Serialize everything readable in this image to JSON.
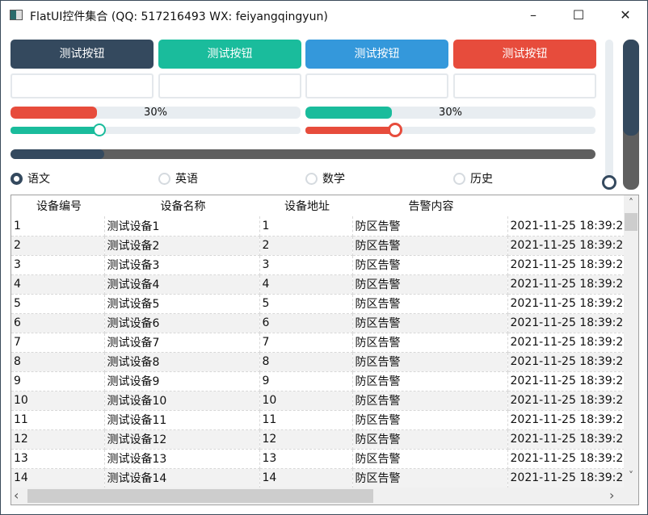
{
  "window": {
    "title": "FlatUI控件集合 (QQ: 517216493 WX: feiyangqingyun)",
    "minimize": "–",
    "maximize": "☐",
    "close": "✕"
  },
  "buttons": [
    {
      "label": "测试按钮",
      "color": "#34495e"
    },
    {
      "label": "测试按钮",
      "color": "#1abc9c"
    },
    {
      "label": "测试按钮",
      "color": "#3498db"
    },
    {
      "label": "测试按钮",
      "color": "#e74c3c"
    }
  ],
  "inputs": [
    {
      "value": ""
    },
    {
      "value": ""
    },
    {
      "value": ""
    },
    {
      "value": ""
    }
  ],
  "progress": [
    {
      "value": 30,
      "text": "30%",
      "color": "#e74c3c"
    },
    {
      "value": 30,
      "text": "30%",
      "color": "#1abc9c"
    }
  ],
  "sliders": [
    {
      "value": 30,
      "color": "#1abc9c"
    },
    {
      "value": 30,
      "color": "#e74c3c"
    }
  ],
  "hprogress": {
    "value": 16,
    "color": "#34495e",
    "track": "#5f5f5f"
  },
  "vslider": {
    "value": 0
  },
  "vprogress": {
    "value": 64
  },
  "radios": [
    {
      "label": "语文",
      "checked": true
    },
    {
      "label": "英语",
      "checked": false
    },
    {
      "label": "数学",
      "checked": false
    },
    {
      "label": "历史",
      "checked": false
    }
  ],
  "table": {
    "headers": [
      "设备编号",
      "设备名称",
      "设备地址",
      "告警内容",
      ""
    ],
    "rows": [
      [
        "1",
        "测试设备1",
        "1",
        "防区告警",
        "2021-11-25 18:39:2"
      ],
      [
        "2",
        "测试设备2",
        "2",
        "防区告警",
        "2021-11-25 18:39:2"
      ],
      [
        "3",
        "测试设备3",
        "3",
        "防区告警",
        "2021-11-25 18:39:2"
      ],
      [
        "4",
        "测试设备4",
        "4",
        "防区告警",
        "2021-11-25 18:39:2"
      ],
      [
        "5",
        "测试设备5",
        "5",
        "防区告警",
        "2021-11-25 18:39:2"
      ],
      [
        "6",
        "测试设备6",
        "6",
        "防区告警",
        "2021-11-25 18:39:2"
      ],
      [
        "7",
        "测试设备7",
        "7",
        "防区告警",
        "2021-11-25 18:39:2"
      ],
      [
        "8",
        "测试设备8",
        "8",
        "防区告警",
        "2021-11-25 18:39:2"
      ],
      [
        "9",
        "测试设备9",
        "9",
        "防区告警",
        "2021-11-25 18:39:2"
      ],
      [
        "10",
        "测试设备10",
        "10",
        "防区告警",
        "2021-11-25 18:39:2"
      ],
      [
        "11",
        "测试设备11",
        "11",
        "防区告警",
        "2021-11-25 18:39:2"
      ],
      [
        "12",
        "测试设备12",
        "12",
        "防区告警",
        "2021-11-25 18:39:2"
      ],
      [
        "13",
        "测试设备13",
        "13",
        "防区告警",
        "2021-11-25 18:39:2"
      ],
      [
        "14",
        "测试设备14",
        "14",
        "防区告警",
        "2021-11-25 18:39:2"
      ]
    ]
  },
  "scroll": {
    "up": "˄",
    "down": "˅",
    "left": "‹",
    "right": "›"
  }
}
